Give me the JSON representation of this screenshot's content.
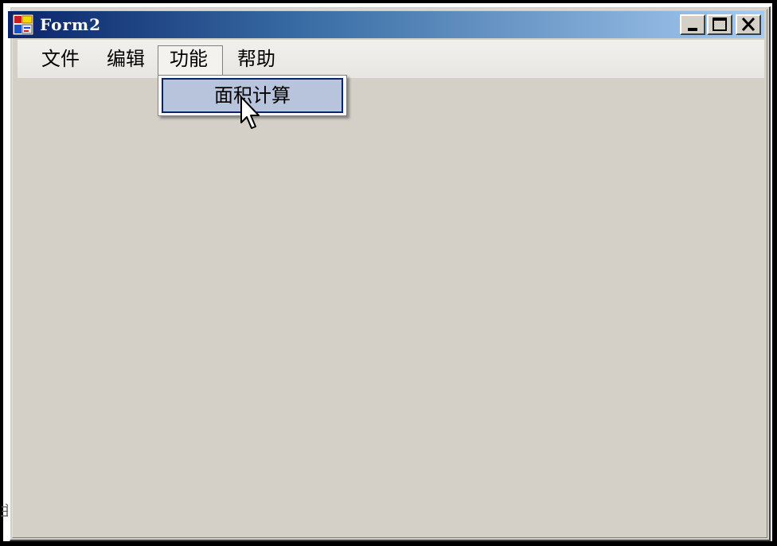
{
  "window": {
    "title": "Form2",
    "icon": "app-form-icon",
    "controls": {
      "minimize_icon": "minimize-icon",
      "maximize_icon": "maximize-icon",
      "close_icon": "close-icon"
    }
  },
  "menubar": {
    "items": [
      {
        "label": "文件"
      },
      {
        "label": "编辑"
      },
      {
        "label": "功能"
      },
      {
        "label": "帮助"
      }
    ],
    "open_index": 2
  },
  "dropdown": {
    "items": [
      {
        "label": "面积计算",
        "highlighted": true
      }
    ]
  },
  "side_fragment": "主",
  "colors": {
    "titlebar_start": "#0a246a",
    "titlebar_end": "#a6caf0",
    "client_bg": "#d4d0c8",
    "highlight_bg": "#b8c4dc",
    "highlight_border": "#0a246a"
  },
  "cursor": {
    "icon": "arrow-pointer-icon"
  }
}
